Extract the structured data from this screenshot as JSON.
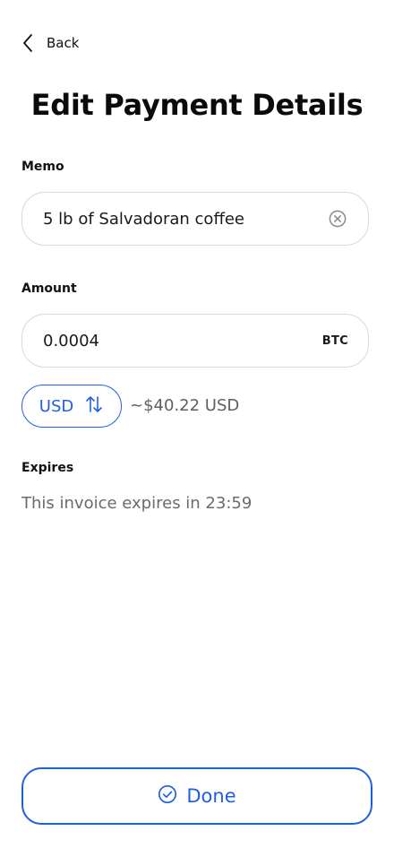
{
  "nav": {
    "back_label": "Back",
    "back_icon": "chevron-left-icon"
  },
  "page": {
    "title": "Edit Payment Details"
  },
  "memo": {
    "label": "Memo",
    "value": "5 lb of Salvadoran coffee",
    "clear_icon": "clear-circle-icon"
  },
  "amount": {
    "label": "Amount",
    "value": "0.0004",
    "unit": "BTC"
  },
  "currency": {
    "selected": "USD",
    "swap_icon": "swap-arrows-icon",
    "converted_text": "~$40.22 USD"
  },
  "expires": {
    "label": "Expires",
    "text": "This invoice expires in 23:59"
  },
  "actions": {
    "done_label": "Done",
    "done_icon": "check-circle-icon"
  },
  "colors": {
    "accent": "#1f5fe0",
    "border": "#d9d9d9",
    "muted_text": "#6b6b6b"
  }
}
